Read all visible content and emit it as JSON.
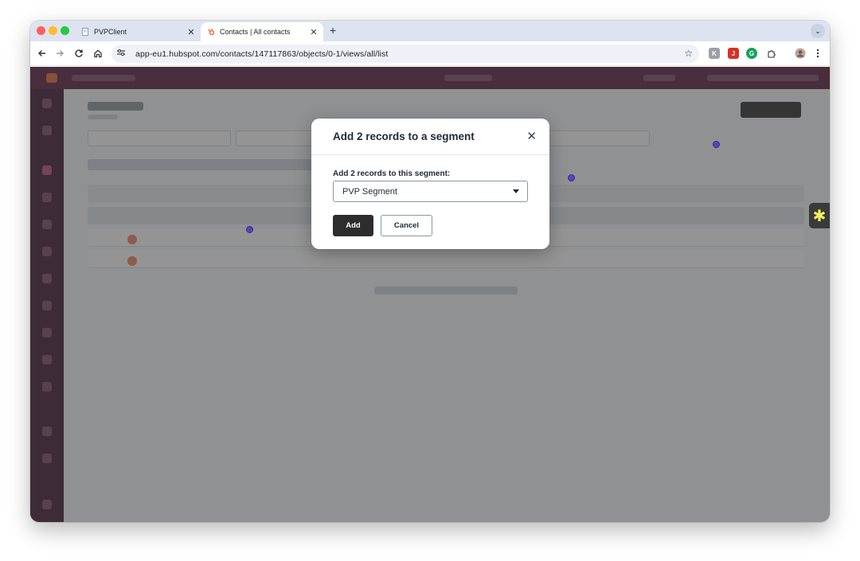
{
  "browser": {
    "tabs": [
      {
        "title": "PVPClient",
        "favicon": "document-icon",
        "close": "✕"
      },
      {
        "title": "Contacts | All contacts",
        "favicon": "hubspot-sprocket-icon",
        "close": "✕"
      }
    ],
    "new_tab": "+",
    "tab_menu": "⌄",
    "address_bar": {
      "url": "app-eu1.hubspot.com/contacts/147117863/objects/0-1/views/all/list"
    },
    "extensions": [
      "extension-k-icon",
      "extension-j-icon",
      "extension-grammarly-icon",
      "extensions-puzzle-icon"
    ],
    "ext_labels": {
      "k": "K",
      "j": "J",
      "g": "G"
    }
  },
  "modal": {
    "title": "Add 2 records to a segment",
    "close_glyph": "✕",
    "field_label": "Add 2 records to this segment:",
    "select_value": "PVP Segment",
    "add_button": "Add",
    "cancel_button": "Cancel"
  },
  "side_widget": {
    "icon": "asterisk-icon",
    "glyph": "✱"
  },
  "colors": {
    "hubspot_topnav": "#5a1e3f",
    "overlay": "rgba(60,60,60,0.55)",
    "primary_button": "#2d2d2d",
    "cursor_marker": "#5b3fc4"
  }
}
